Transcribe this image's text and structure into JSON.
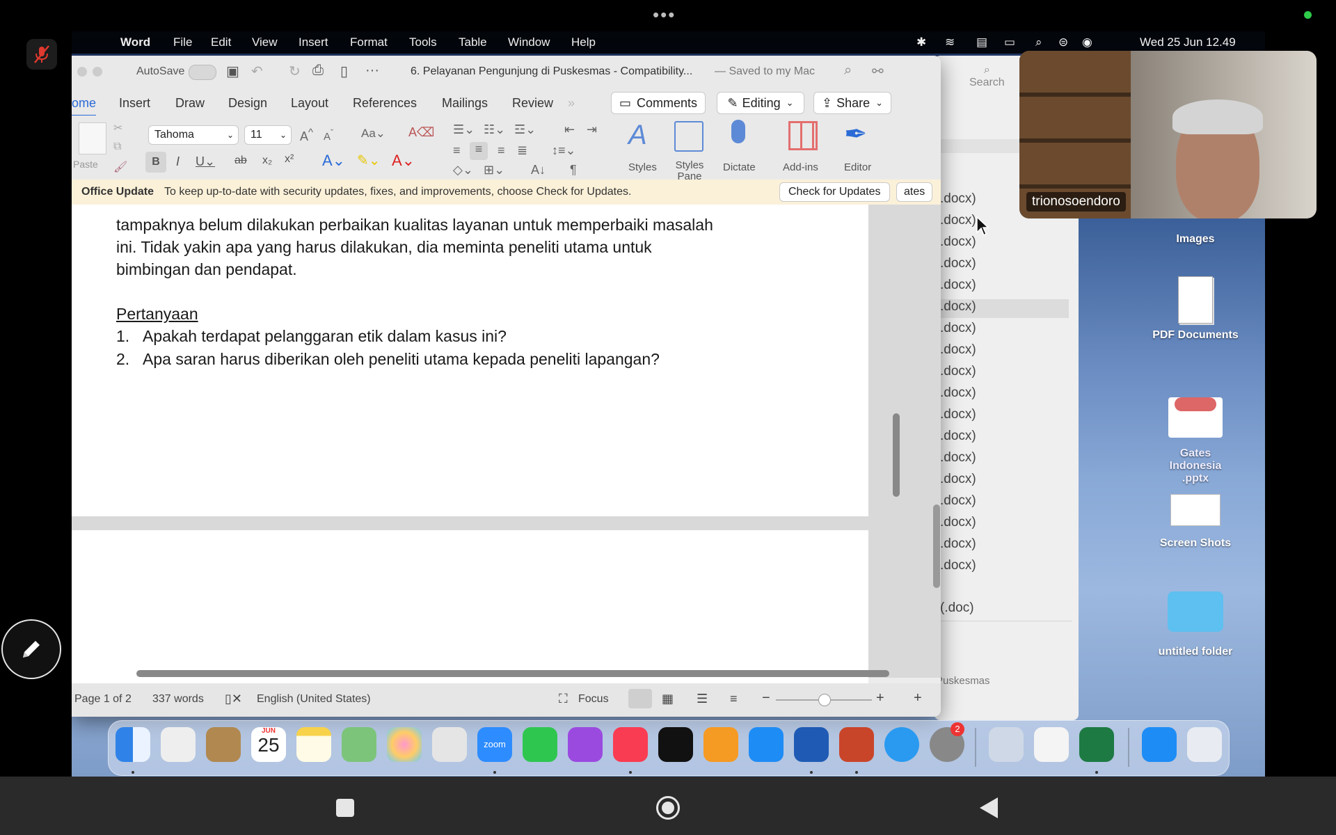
{
  "menubar": {
    "app_name": "Word",
    "menus": [
      "File",
      "Edit",
      "View",
      "Insert",
      "Format",
      "Tools",
      "Table",
      "Window",
      "Help"
    ],
    "clock": "Wed 25 Jun  12.49"
  },
  "word": {
    "autosave_label": "AutoSave",
    "document_title": "6. Pelayanan Pengunjung di Puskesmas  -  Compatibility...",
    "save_status": "— Saved to my Mac",
    "tabs": [
      "ome",
      "Insert",
      "Draw",
      "Design",
      "Layout",
      "References",
      "Mailings",
      "Review"
    ],
    "comments_label": "Comments",
    "editing_label": "Editing",
    "share_label": "Share",
    "font_name": "Tahoma",
    "font_size": "11",
    "paste_label": "Paste",
    "tools": [
      "Styles",
      "Styles Pane",
      "Dictate",
      "Add-ins",
      "Editor"
    ],
    "update_title": "Office Update",
    "update_message": "To keep up-to-date with security updates, fixes, and improvements, choose Check for Updates.",
    "check_updates_label": "Check for Updates",
    "doc_lines": [
      "tampaknya belum dilakukan perbaikan kualitas layanan untuk memperbaiki masalah",
      "ini. Tidak yakin apa yang harus dilakukan, dia meminta peneliti utama untuk",
      "bimbingan dan pendapat."
    ],
    "question_heading": "Pertanyaan",
    "questions": [
      {
        "num": "1.",
        "text": "Apakah terdapat pelanggaran etik dalam kasus ini?"
      },
      {
        "num": "2.",
        "text": "Apa saran harus diberikan oleh peneliti utama kepada peneliti lapangan?"
      }
    ],
    "status_page": "Page 1 of 2",
    "status_words": "337 words",
    "status_language": "English (United States)",
    "status_focus": "Focus"
  },
  "finder": {
    "search_label": "Search",
    "share_fragment": "re",
    "updates_fragment": "ates",
    "files": [
      ".docx)",
      ".docx)",
      ".docx)",
      ".docx)",
      ".docx)",
      ".docx)",
      ".docx)",
      ".docx)",
      ".docx)",
      ".docx)",
      ".docx)",
      ".docx)",
      ".docx)",
      ".docx)",
      ".docx)",
      ".docx)",
      ".docx)",
      ".docx)"
    ],
    "doc_file": "(.doc)",
    "footer": "Puskesmas"
  },
  "desktop": {
    "icons": [
      "Images",
      "PDF Documents",
      "Gates Indonesia  .pptx",
      "Screen Shots",
      "untitled folder"
    ]
  },
  "dock": {
    "calendar_month": "JUN",
    "calendar_day": "25",
    "zoom_label": "zoom",
    "settings_badge": "2"
  },
  "video": {
    "participant_name": "trionosoendoro"
  },
  "colors": {
    "accent_blue": "#2b6bd6",
    "word_blue": "#1f5bb4",
    "excel_green": "#1d7a43",
    "ppt_red": "#c9452a",
    "update_bar": "#fbf1d9",
    "red_mute": "#e0392f"
  }
}
